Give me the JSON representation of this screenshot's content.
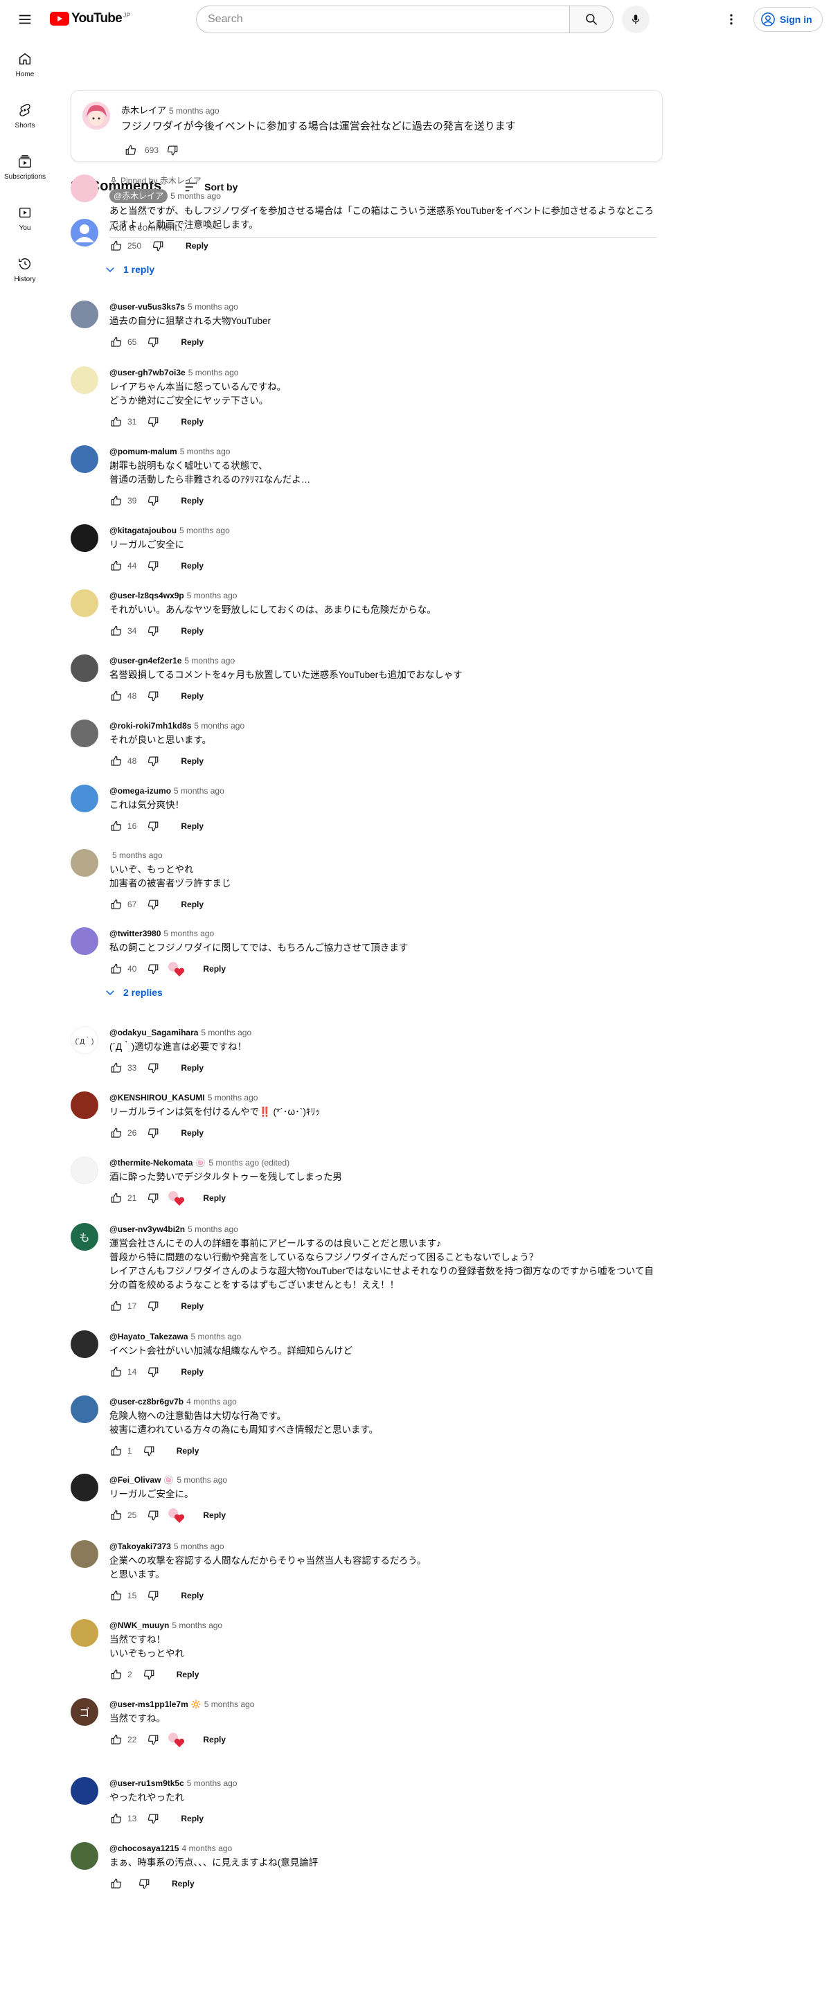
{
  "header": {
    "logo_text": "YouTube",
    "logo_region": "JP",
    "search_placeholder": "Search",
    "signin_label": "Sign in"
  },
  "sidebar": {
    "items": [
      {
        "label": "Home"
      },
      {
        "label": "Shorts"
      },
      {
        "label": "Subscriptions"
      },
      {
        "label": "You"
      },
      {
        "label": "History"
      }
    ]
  },
  "video_comment": {
    "author": "赤木レイア",
    "time": "5 months ago",
    "text": "フジノワダイが今後イベントに参加する場合は運営会社などに過去の発言を送ります",
    "likes": "693"
  },
  "comments_section": {
    "count_label": "27 Comments",
    "sort_label": "Sort by",
    "add_placeholder": "Add a comment..."
  },
  "comments": [
    {
      "pinned_by": "Pinned by 赤木レイア",
      "author": "@赤木レイア",
      "owner": true,
      "time": "5 months ago",
      "text": "あと当然ですが、もしフジノワダイを参加させる場合は「この箱はこういう迷惑系YouTuberをイベントに参加させるようなところですよ」と動画で注意喚起します。",
      "likes": "250",
      "replies": "1 reply",
      "avatar_color": "#f7c6d4"
    },
    {
      "author": "@user-vu5us3ks7s",
      "time": "5 months ago",
      "text": "過去の自分に狙撃される大物YouTuber",
      "likes": "65",
      "avatar_color": "#7d8aa3"
    },
    {
      "author": "@user-gh7wb7oi3e",
      "time": "5 months ago",
      "text": "レイアちゃん本当に怒っているんですね。\nどうか絶対にご安全にヤッテ下さい。",
      "likes": "31",
      "avatar_color": "#f2e9b8"
    },
    {
      "author": "@pomum-malum",
      "time": "5 months ago",
      "text": "謝罪も説明もなく嘘吐いてる状態で、\n普通の活動したら非難されるのｱﾀﾘﾏｴなんだよ…",
      "likes": "39",
      "avatar_color": "#3d6fb3"
    },
    {
      "author": "@kitagatajoubou",
      "time": "5 months ago",
      "text": "リーガルご安全に",
      "likes": "44",
      "avatar_color": "#1a1a1a"
    },
    {
      "author": "@user-lz8qs4wx9p",
      "time": "5 months ago",
      "text": "それがいい。あんなヤツを野放しにしておくのは、あまりにも危険だからな。",
      "likes": "34",
      "avatar_color": "#e8d58a"
    },
    {
      "author": "@user-gn4ef2er1e",
      "time": "5 months ago",
      "text": "名誉毀損してるコメントを4ヶ月も放置していた迷惑系YouTuberも追加でおなしゃす",
      "likes": "48",
      "avatar_color": "#555555"
    },
    {
      "author": "@roki-roki7mh1kd8s",
      "time": "5 months ago",
      "text": "それが良いと思います。",
      "likes": "48",
      "avatar_color": "#6b6b6b"
    },
    {
      "author": "@omega-izumo",
      "time": "5 months ago",
      "text": "これは気分爽快！",
      "likes": "16",
      "avatar_color": "#4a90d9"
    },
    {
      "author": "",
      "time": "5 months ago",
      "text": "いいぞ、もっとやれ\n加害者の被害者ヅラ許すまじ",
      "likes": "67",
      "avatar_color": "#b5a98a"
    },
    {
      "author": "@twitter3980",
      "time": "5 months ago",
      "text": "私の飼ことフジノワダイに関してでは、もちろんご協力させて頂きます",
      "likes": "40",
      "hearted": true,
      "replies": "2 replies",
      "avatar_color": "#8a7ad6"
    },
    {
      "author": "@odakyu_Sagamihara",
      "time": "5 months ago",
      "text": "(´Д｀)適切な進言は必要ですね！",
      "likes": "33",
      "avatar_color": "#ffffff",
      "avatar_text": "(´Д｀)"
    },
    {
      "author": "@KENSHIROU_KASUMI",
      "time": "5 months ago",
      "text": "リーガルラインは気を付けるんやで‼️ (*´･ω･`)ｷﾘｯ",
      "likes": "26",
      "avatar_color": "#8b2a1a"
    },
    {
      "author": "@thermite-Nekomata",
      "badge": "🍥",
      "time": "5 months ago (edited)",
      "text": "酒に酔った勢いでデジタルタトゥーを残してしまった男",
      "likes": "21",
      "hearted": true,
      "avatar_color": "#f4f4f4"
    },
    {
      "author": "@user-nv3yw4bi2n",
      "time": "5 months ago",
      "text": "運営会社さんにその人の詳細を事前にアピールするのは良いことだと思います♪\n普段から特に問題のない行動や発言をしているならフジノワダイさんだって困ることもないでしょう？\nレイアさんもフジノワダイさんのような超大物YouTuberではないにせよそれなりの登録者数を持つ御方なのですから嘘をついて自分の首を絞めるようなことをするはずもございませんとも！ええ！！",
      "likes": "17",
      "avatar_color": "#1e6b4a",
      "avatar_text": "も"
    },
    {
      "author": "@Hayato_Takezawa",
      "time": "5 months ago",
      "text": "イベント会社がいい加減な組織なんやろ。詳細知らんけど",
      "likes": "14",
      "avatar_color": "#2b2b2b"
    },
    {
      "author": "@user-cz8br6gv7b",
      "time": "4 months ago",
      "text": "危険人物への注意勧告は大切な行為です。\n被害に遭われている方々の為にも周知すべき情報だと思います。",
      "likes": "1",
      "avatar_color": "#3a6fa8"
    },
    {
      "author": "@Fei_Olivaw",
      "badge": "🍥",
      "time": "5 months ago",
      "text": "リーガルご安全に。",
      "likes": "25",
      "hearted": true,
      "avatar_color": "#222222"
    },
    {
      "author": "@Takoyaki7373",
      "time": "5 months ago",
      "text": "企業への攻撃を容認する人間なんだからそりゃ当然当人も容認するだろう。\nと思います。",
      "likes": "15",
      "avatar_color": "#8a7a5a"
    },
    {
      "author": "@NWK_muuyn",
      "time": "5 months ago",
      "text": "当然ですね！\nいいぞもっとやれ",
      "likes": "2",
      "avatar_color": "#c9a64a"
    },
    {
      "author": "@user-ms1pp1le7m",
      "badge": "🔆",
      "time": "5 months ago",
      "text": "当然ですね。",
      "likes": "22",
      "hearted": true,
      "avatar_color": "#5d3a2a",
      "avatar_text": "ゴ"
    },
    {
      "author": "@user-ru1sm9tk5c",
      "time": "5 months ago",
      "text": "やったれやったれ",
      "likes": "13",
      "avatar_color": "#1a3a8a"
    },
    {
      "author": "@chocosaya1215",
      "time": "4 months ago",
      "text": "まぁ、時事系の汚点、、、に見えますよね(意見論評",
      "likes": "",
      "avatar_color": "#4a6a3a"
    }
  ]
}
